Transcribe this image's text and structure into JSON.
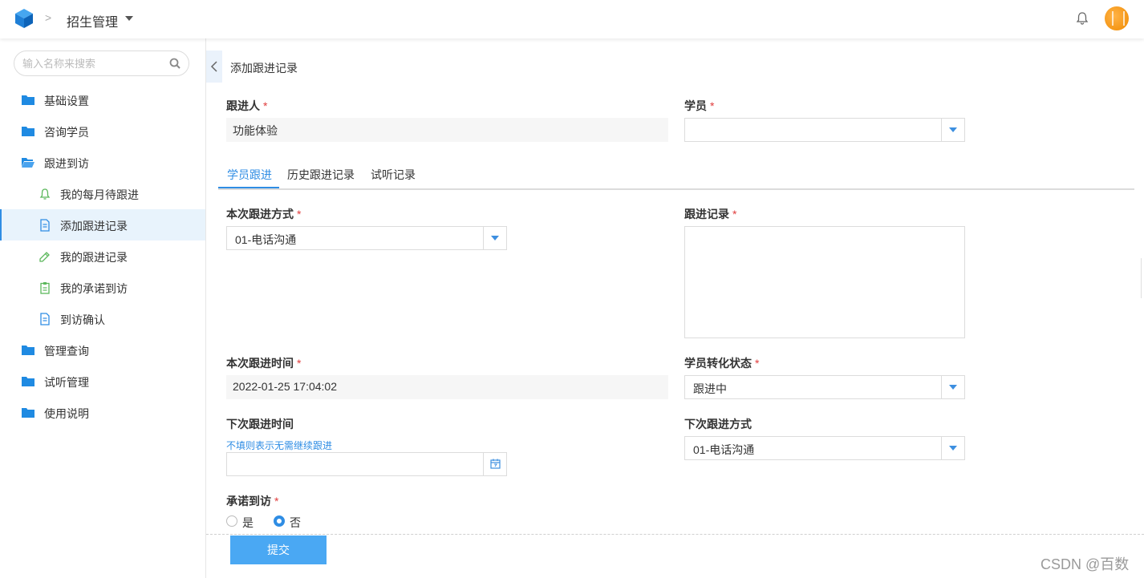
{
  "header": {
    "separator": ">",
    "title": "招生管理"
  },
  "sidebar": {
    "search_placeholder": "输入名称来搜索",
    "items": [
      {
        "label": "基础设置"
      },
      {
        "label": "咨询学员"
      },
      {
        "label": "跟进到访"
      },
      {
        "label": "我的每月待跟进"
      },
      {
        "label": "添加跟进记录"
      },
      {
        "label": "我的跟进记录"
      },
      {
        "label": "我的承诺到访"
      },
      {
        "label": "到访确认"
      },
      {
        "label": "管理查询"
      },
      {
        "label": "试听管理"
      },
      {
        "label": "使用说明"
      }
    ]
  },
  "page": {
    "title": "添加跟进记录"
  },
  "form": {
    "follower_label": "跟进人",
    "follower_value": "功能体验",
    "student_label": "学员",
    "student_value": "",
    "tabs": [
      "学员跟进",
      "历史跟进记录",
      "试听记录"
    ],
    "method_label": "本次跟进方式",
    "method_value": "01-电话沟通",
    "record_label": "跟进记录",
    "record_value": "",
    "time_label": "本次跟进时间",
    "time_value": "2022-01-25 17:04:02",
    "status_label": "学员转化状态",
    "status_value": "跟进中",
    "next_time_label": "下次跟进时间",
    "next_time_hint": "不填则表示无需继续跟进",
    "next_time_value": "",
    "next_method_label": "下次跟进方式",
    "next_method_value": "01-电话沟通",
    "promise_label": "承诺到访",
    "promise_options": [
      "是",
      "否"
    ],
    "promise_selected": "否",
    "required_mark": "*",
    "submit_label": "提交"
  },
  "watermark": "CSDN @百数",
  "colors": {
    "accent": "#2f8de4",
    "button": "#4aa8f3",
    "required": "#e03c3c",
    "folder": "#1f8ae2",
    "sub_icon_green": "#5cb85c"
  }
}
